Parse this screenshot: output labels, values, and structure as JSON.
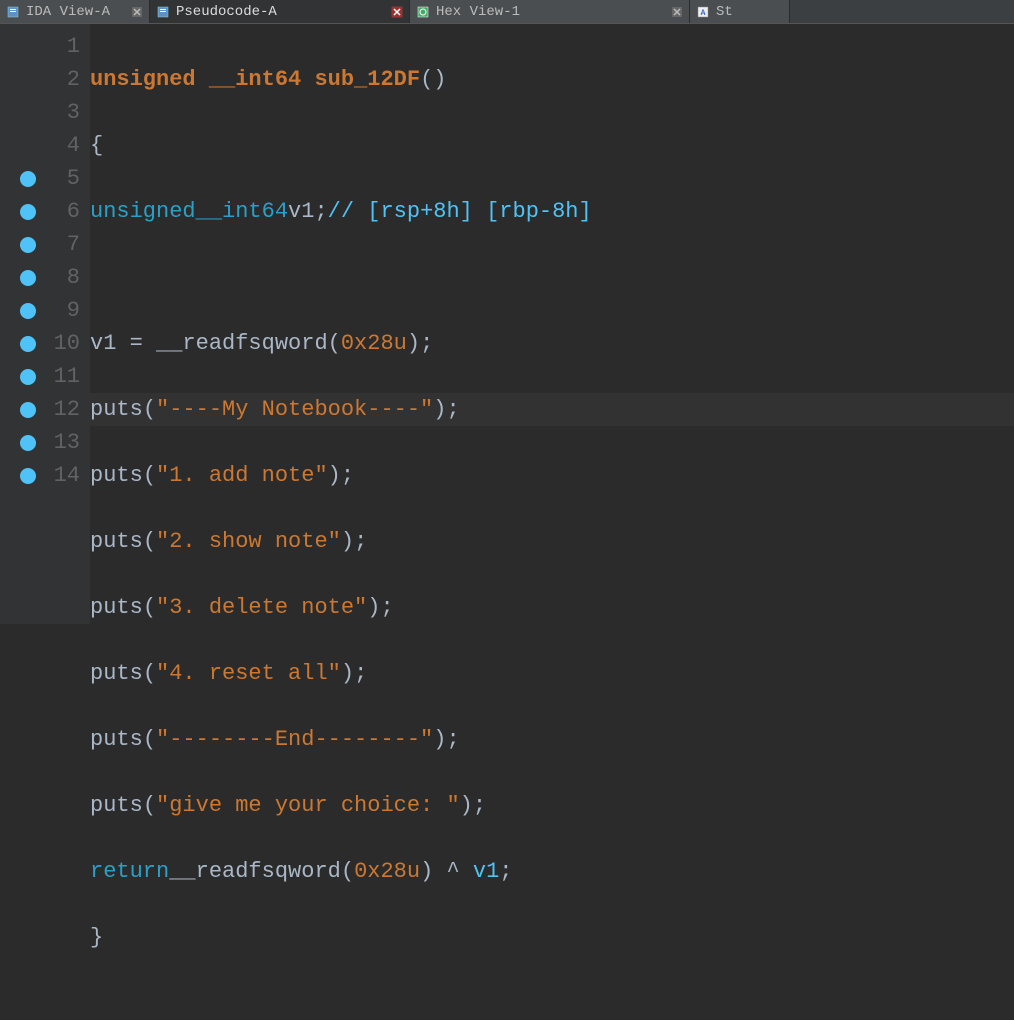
{
  "tabs": [
    {
      "label": "IDA View-A",
      "active": false,
      "closeStyle": "normal"
    },
    {
      "label": "Pseudocode-A",
      "active": true,
      "closeStyle": "red"
    },
    {
      "label": "Hex View-1",
      "active": false,
      "closeStyle": "normal"
    },
    {
      "label": "St",
      "active": false,
      "closeStyle": "none"
    }
  ],
  "lines": [
    {
      "n": 1,
      "bp": false
    },
    {
      "n": 2,
      "bp": false
    },
    {
      "n": 3,
      "bp": false
    },
    {
      "n": 4,
      "bp": false
    },
    {
      "n": 5,
      "bp": true
    },
    {
      "n": 6,
      "bp": true,
      "current": true
    },
    {
      "n": 7,
      "bp": true
    },
    {
      "n": 8,
      "bp": true
    },
    {
      "n": 9,
      "bp": true
    },
    {
      "n": 10,
      "bp": true
    },
    {
      "n": 11,
      "bp": true
    },
    {
      "n": 12,
      "bp": true
    },
    {
      "n": 13,
      "bp": true
    },
    {
      "n": 14,
      "bp": true
    }
  ],
  "code": {
    "sig_pre": "unsigned",
    "sig_type": "__int64",
    "sig_name": "sub_12DF",
    "decl_pre": "unsigned",
    "decl_type": "__int64",
    "decl_var": "v1",
    "decl_cmt": "// [rsp+8h] [rbp-8h]",
    "read_fn": "__readfsqword",
    "read_arg": "0x28u",
    "puts": "puts",
    "s1": "\"----My Notebook----\"",
    "s2": "\"1. add note\"",
    "s3": "\"2. show note\"",
    "s4": "\"3. delete note\"",
    "s5": "\"4. reset all\"",
    "s6": "\"--------End--------\"",
    "s7": "\"give me your choice: \"",
    "ret": "return",
    "xor_var": "v1",
    "brace_open": "{",
    "brace_close": "}",
    "paren_empty": "()",
    "semi": ";",
    "eq": " = ",
    "caret": " ^ "
  }
}
